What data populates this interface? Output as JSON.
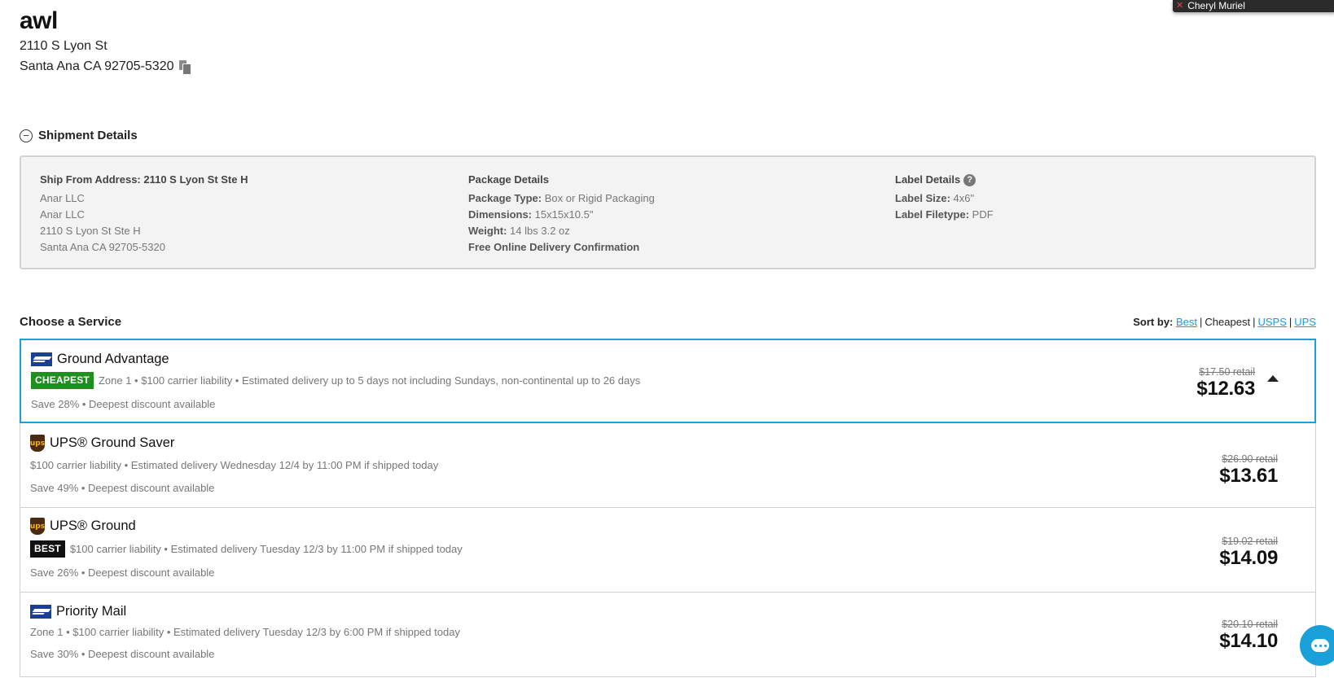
{
  "recipient": {
    "name": "awl",
    "address_line1": "2110 S Lyon St",
    "address_line2": "Santa Ana CA 92705-5320"
  },
  "user_chip": {
    "name": "Cheryl Muriel"
  },
  "shipment": {
    "toggle_label": "Shipment Details",
    "ship_from": {
      "heading": "Ship From Address: 2110 S Lyon St Ste H",
      "lines": [
        "Anar LLC",
        "Anar LLC",
        "2110 S Lyon St Ste H",
        "Santa Ana CA 92705-5320"
      ]
    },
    "package": {
      "heading": "Package Details",
      "type_label": "Package Type:",
      "type_value": "Box or Rigid Packaging",
      "dims_label": "Dimensions:",
      "dims_value": "15x15x10.5\"",
      "weight_label": "Weight:",
      "weight_value": "14 lbs 3.2 oz",
      "confirmation": "Free Online Delivery Confirmation"
    },
    "label": {
      "heading": "Label Details",
      "size_label": "Label Size:",
      "size_value": "4x6\"",
      "filetype_label": "Label Filetype:",
      "filetype_value": "PDF"
    }
  },
  "choose": {
    "title": "Choose a Service",
    "sort_label": "Sort by:",
    "sort_options": [
      "Best",
      "Cheapest",
      "USPS",
      "UPS"
    ]
  },
  "services": [
    {
      "carrier_icon": "usps-icon",
      "name": "Ground Advantage",
      "badge": "CHEAPEST",
      "info": "Zone 1 • $100 carrier liability • Estimated delivery up to 5 days not including Sundays, non-continental up to 26 days",
      "save": "Save 28% • Deepest discount available",
      "retail": "$17.50 retail",
      "price": "$12.63"
    },
    {
      "carrier_icon": "ups-icon",
      "name": "UPS® Ground Saver",
      "badge": "",
      "info": "$100 carrier liability • Estimated delivery Wednesday 12/4 by 11:00 PM if shipped today",
      "save": "Save 49% • Deepest discount available",
      "retail": "$26.90 retail",
      "price": "$13.61"
    },
    {
      "carrier_icon": "ups-icon",
      "name": "UPS® Ground",
      "badge": "BEST",
      "info": "$100 carrier liability • Estimated delivery Tuesday 12/3 by 11:00 PM if shipped today",
      "save": "Save 26% • Deepest discount available",
      "retail": "$19.02 retail",
      "price": "$14.09"
    },
    {
      "carrier_icon": "usps-icon",
      "name": "Priority Mail",
      "badge": "",
      "info": "Zone 1 • $100 carrier liability • Estimated delivery Tuesday 12/3 by 6:00 PM if shipped today",
      "save": "Save 30% • Deepest discount available",
      "retail": "$20.10 retail",
      "price": "$14.10"
    }
  ],
  "colors": {
    "accent": "#1aa0d8",
    "cheapest_badge": "#1f8f1f",
    "best_badge": "#111111"
  }
}
